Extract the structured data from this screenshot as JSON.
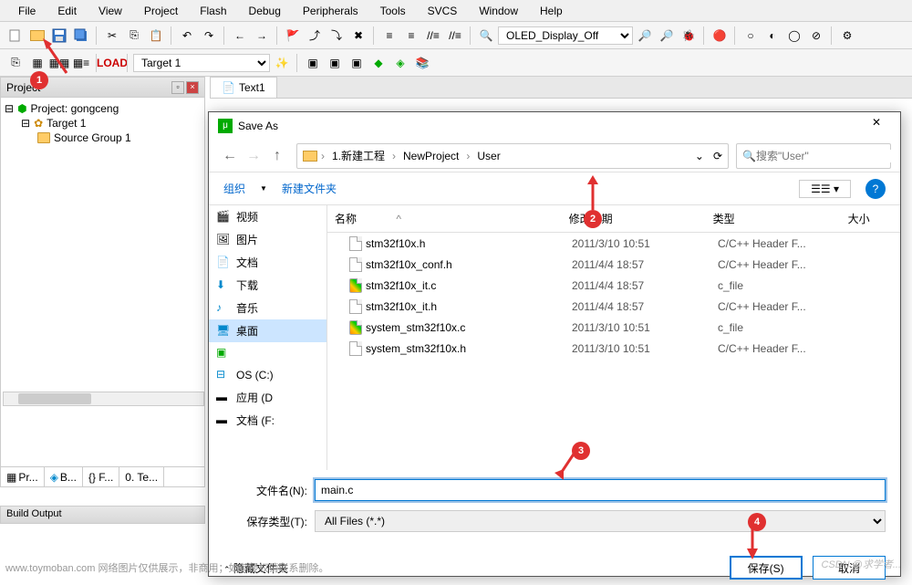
{
  "menu": [
    "File",
    "Edit",
    "View",
    "Project",
    "Flash",
    "Debug",
    "Peripherals",
    "Tools",
    "SVCS",
    "Window",
    "Help"
  ],
  "toolbar": {
    "combo1": "OLED_Display_Off"
  },
  "toolbar2": {
    "target_combo": "Target 1"
  },
  "project": {
    "title": "Project",
    "root": "Project: gongceng",
    "target": "Target 1",
    "group": "Source Group 1"
  },
  "bottom_tabs": [
    "Pr...",
    "B...",
    "{} F...",
    "0. Te..."
  ],
  "editor": {
    "tab": "Text1"
  },
  "build_output": "Build Output",
  "dialog": {
    "title": "Save As",
    "path": [
      "1.新建工程",
      "NewProject",
      "User"
    ],
    "search_placeholder": "搜索\"User\"",
    "organize": "组织",
    "new_folder": "新建文件夹",
    "sidebar": [
      "视频",
      "图片",
      "文档",
      "下载",
      "音乐",
      "桌面",
      "",
      "OS (C:)",
      "应用 (D",
      "文档 (F:"
    ],
    "columns": {
      "name": "名称",
      "date": "修改日期",
      "type": "类型",
      "size": "大小"
    },
    "files": [
      {
        "name": "stm32f10x.h",
        "date": "2011/3/10 10:51",
        "type": "C/C++ Header F...",
        "icon": "h"
      },
      {
        "name": "stm32f10x_conf.h",
        "date": "2011/4/4 18:57",
        "type": "C/C++ Header F...",
        "icon": "h"
      },
      {
        "name": "stm32f10x_it.c",
        "date": "2011/4/4 18:57",
        "type": "c_file",
        "icon": "c"
      },
      {
        "name": "stm32f10x_it.h",
        "date": "2011/4/4 18:57",
        "type": "C/C++ Header F...",
        "icon": "h"
      },
      {
        "name": "system_stm32f10x.c",
        "date": "2011/3/10 10:51",
        "type": "c_file",
        "icon": "c"
      },
      {
        "name": "system_stm32f10x.h",
        "date": "2011/3/10 10:51",
        "type": "C/C++ Header F...",
        "icon": "h"
      }
    ],
    "filename_label": "文件名(N):",
    "filetype_label": "保存类型(T):",
    "filename_value": "main.c",
    "filetype_value": "All Files (*.*)",
    "hide_folders": "隐藏文件夹",
    "save_btn": "保存(S)",
    "cancel_btn": "取消"
  },
  "annotations": {
    "a1": "1",
    "a2": "2",
    "a3": "3",
    "a4": "4"
  },
  "watermark": "www.toymoban.com  网络图片仅供展示，非商用；如有侵权请联系删除。",
  "watermark2": "CSDN @求学者..."
}
